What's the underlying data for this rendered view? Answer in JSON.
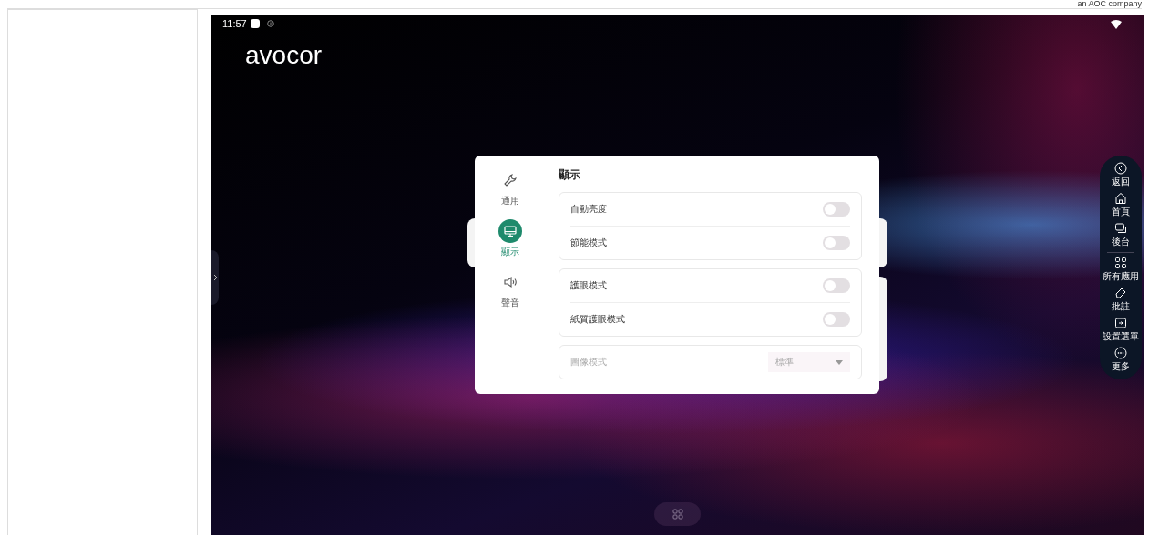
{
  "header": {
    "tagline": "an AOC company"
  },
  "screen": {
    "status_bar": {
      "time": "11:57"
    },
    "logo": "avocor",
    "settings": {
      "title": "顯示",
      "nav": [
        {
          "label": "通用",
          "kind": "wrench",
          "selected": false
        },
        {
          "label": "顯示",
          "kind": "monitor",
          "selected": true
        },
        {
          "label": "聲音",
          "kind": "speaker",
          "selected": false
        }
      ],
      "groups": [
        {
          "rows": [
            {
              "kind": "toggle",
              "label": "自動亮度",
              "on": false
            },
            {
              "kind": "toggle",
              "label": "節能模式",
              "on": false
            }
          ]
        },
        {
          "rows": [
            {
              "kind": "toggle",
              "label": "護眼模式",
              "on": false
            },
            {
              "kind": "toggle",
              "label": "紙質護眼模式",
              "on": false
            }
          ]
        },
        {
          "rows": [
            {
              "kind": "dropdown",
              "label": "圖像模式",
              "value": "標準",
              "disabled": true
            }
          ]
        }
      ]
    },
    "side_toolbar": {
      "items": [
        {
          "kind": "back",
          "label": "返回"
        },
        {
          "kind": "home",
          "label": "首頁"
        },
        {
          "kind": "windows",
          "label": "後台"
        },
        {
          "kind": "apps",
          "label": "所有應用"
        },
        {
          "kind": "pen",
          "label": "批註"
        },
        {
          "kind": "input",
          "label": "設置選單"
        },
        {
          "kind": "more",
          "label": "更多"
        }
      ]
    }
  }
}
